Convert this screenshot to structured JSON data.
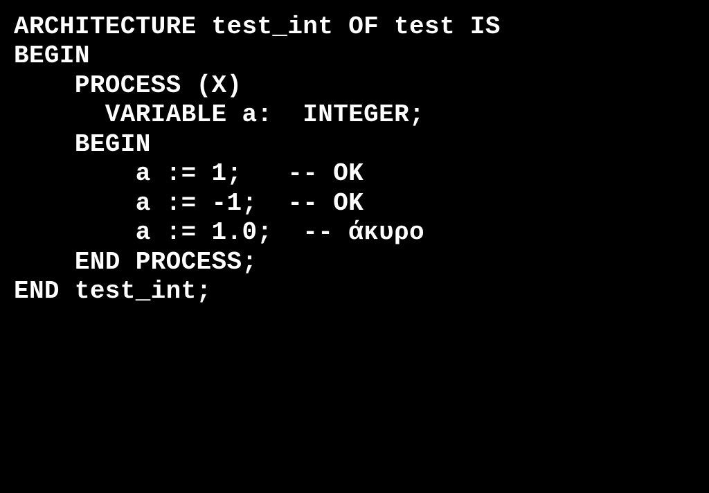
{
  "code": {
    "lines": [
      {
        "id": "line1",
        "text": "ARCHITECTURE test_int OF test IS",
        "indent": 0
      },
      {
        "id": "line2",
        "text": "BEGIN",
        "indent": 0
      },
      {
        "id": "line3",
        "text": "    PROCESS (X)",
        "indent": 0
      },
      {
        "id": "line4",
        "text": "      VARIABLE a:  INTEGER;",
        "indent": 0
      },
      {
        "id": "line5",
        "text": "    BEGIN",
        "indent": 0
      },
      {
        "id": "line6",
        "text": "        a := 1;   -- OK",
        "indent": 0
      },
      {
        "id": "line7",
        "text": "        a := -1;  -- OK",
        "indent": 0
      },
      {
        "id": "line8",
        "text": "        a := 1.0;  -- άκυρο",
        "indent": 0
      },
      {
        "id": "line9",
        "text": "    END PROCESS;",
        "indent": 0
      },
      {
        "id": "line10",
        "text": "END test_int;",
        "indent": 0
      }
    ]
  }
}
